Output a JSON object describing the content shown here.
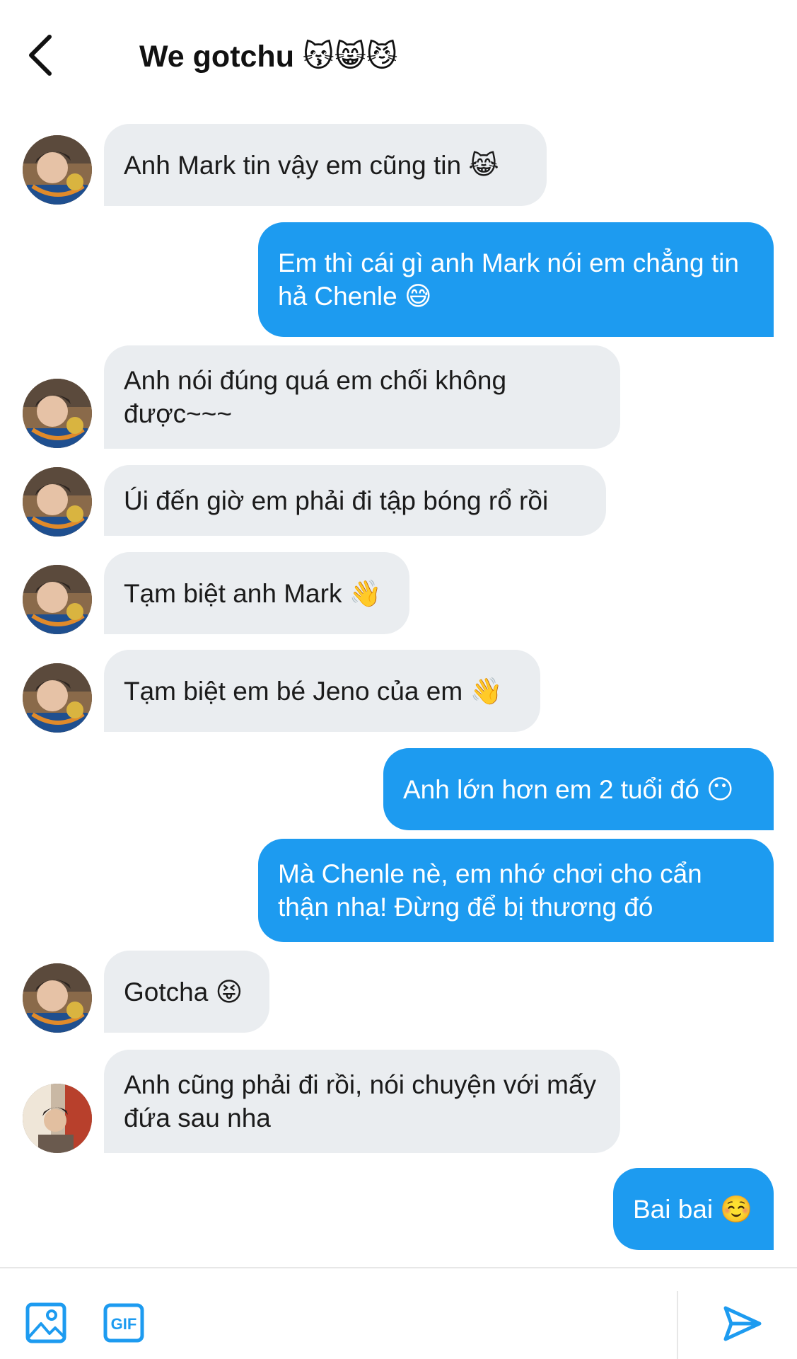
{
  "header": {
    "title": "We gotchu 😽😸😼"
  },
  "messages": [
    {
      "from": "them",
      "avatar": "chenle",
      "text": "Anh Mark tin vậy em cũng tin 😹"
    },
    {
      "from": "me",
      "text": "Em thì cái gì anh Mark nói em chẳng tin hả Chenle 😅"
    },
    {
      "from": "them",
      "avatar": "chenle",
      "text": "Anh nói đúng quá em chối không được~~~"
    },
    {
      "from": "them",
      "avatar": "chenle",
      "text": "Úi đến giờ em phải đi tập bóng rổ rồi"
    },
    {
      "from": "them",
      "avatar": "chenle",
      "text": "Tạm biệt anh Mark 👋"
    },
    {
      "from": "them",
      "avatar": "chenle",
      "text": "Tạm biệt em bé Jeno của em 👋"
    },
    {
      "from": "me",
      "text": "Anh lớn hơn em 2 tuổi đó 😶"
    },
    {
      "from": "me",
      "text": "Mà Chenle nè, em nhớ chơi cho cẩn thận nha! Đừng để bị thương đó"
    },
    {
      "from": "them",
      "avatar": "chenle",
      "text": "Gotcha 😝"
    },
    {
      "from": "them",
      "avatar": "other",
      "text": "Anh cũng phải đi rồi, nói chuyện với mấy đứa sau nha"
    },
    {
      "from": "me",
      "text": "Bai bai ☺️"
    }
  ],
  "toolbar": {
    "media_icon": "image-icon",
    "gif_label": "GIF",
    "send_icon": "send-icon"
  },
  "colors": {
    "accent": "#1d9bf0",
    "bubble_them": "#eaedf0"
  }
}
